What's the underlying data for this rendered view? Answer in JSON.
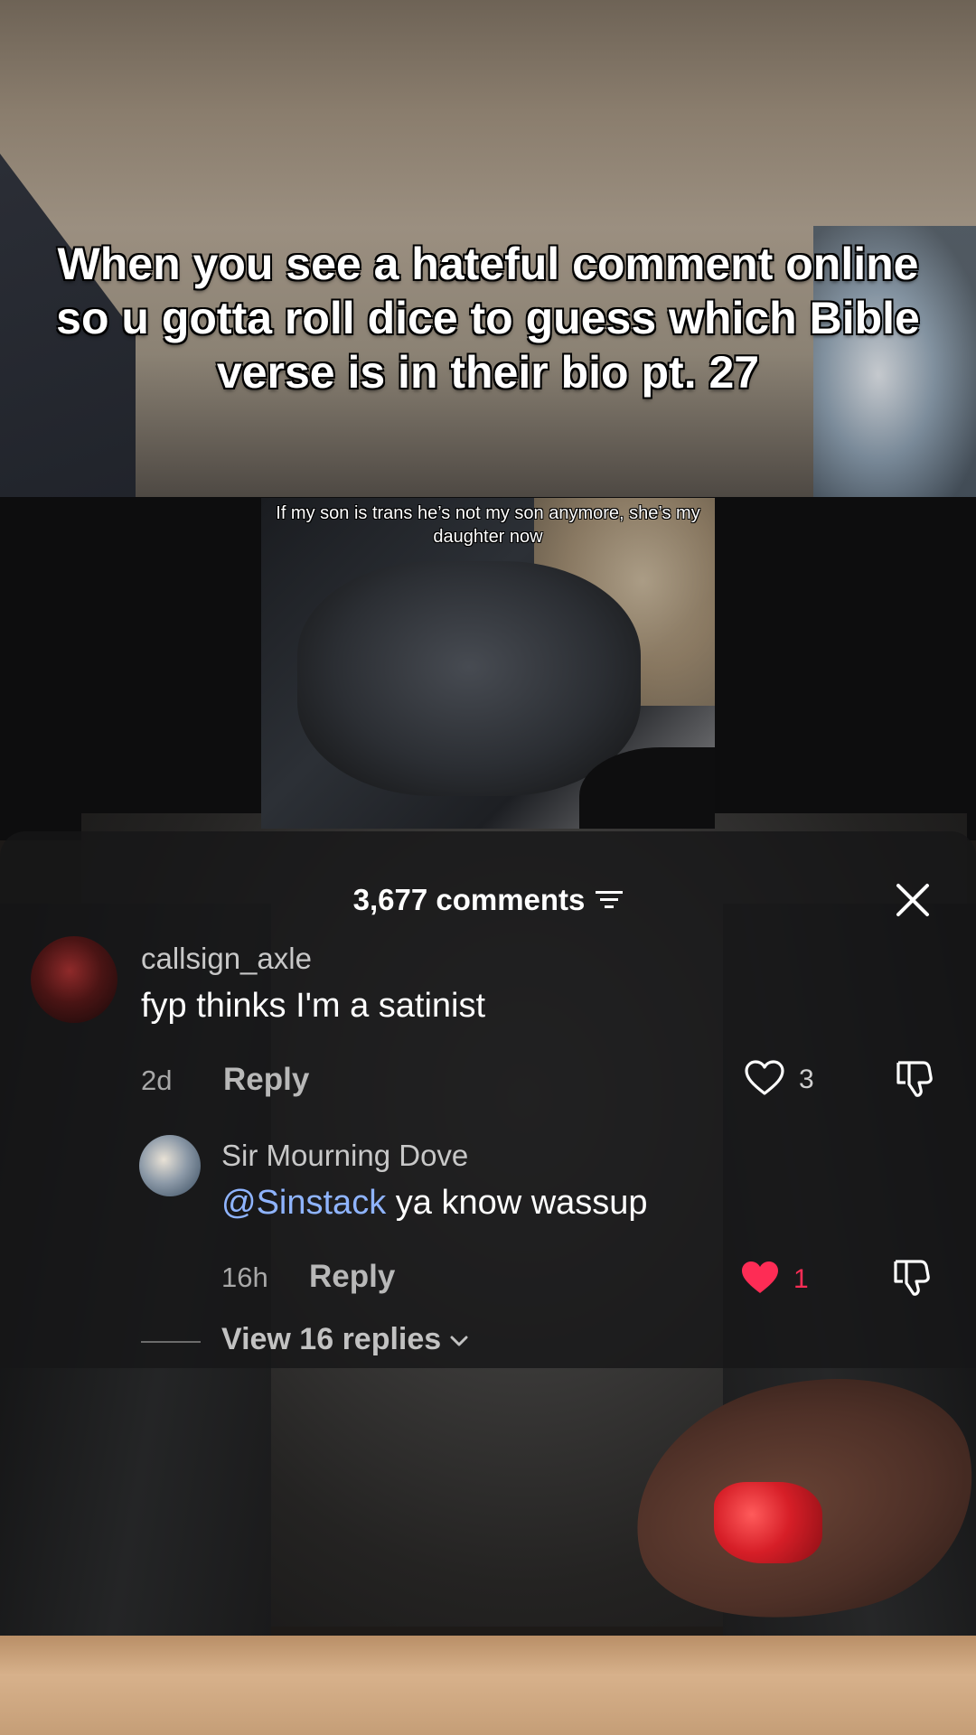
{
  "caption": "When you see a hateful comment online so u gotta roll dice to guess which Bible verse is in their bio pt. 27",
  "embedded_video": {
    "overlay_text": "If my son is trans he’s not my son anymore, she’s my daughter now"
  },
  "comments_panel": {
    "count_label": "3,677 comments",
    "filter_icon": "filter-icon",
    "close_icon": "close-icon",
    "comments": [
      {
        "username": "callsign_axle",
        "text": "fyp thinks I'm a satinist",
        "age": "2d",
        "reply_label": "Reply",
        "likes": "3",
        "liked": false
      },
      {
        "username": "Sir Mourning Dove",
        "mention": "@Sinstack",
        "text": "ya know wassup",
        "age": "16h",
        "reply_label": "Reply",
        "likes": "1",
        "liked": true
      }
    ],
    "view_replies_label": "View 16 replies"
  },
  "colors": {
    "like_active": "#fe2c55",
    "mention": "#8fb4ff",
    "panel_bg": "#161618"
  }
}
